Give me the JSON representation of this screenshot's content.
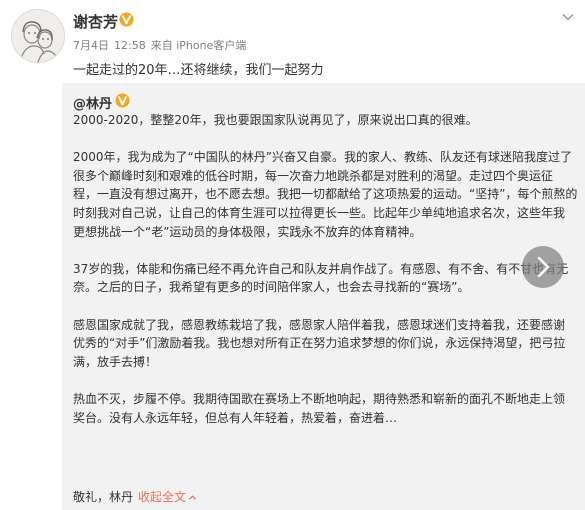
{
  "post": {
    "author_name": "谢杏芳",
    "date": "7月4日",
    "time": "12:58",
    "source": "来自 iPhone客户端",
    "text": "一起走过的20年…还将继续，我们一起努力"
  },
  "repost": {
    "author": "@林丹",
    "paragraphs": [
      "2000-2020，整整20年，我也要跟国家队说再见了，原来说出口真的很难。",
      "2000年，我为成为了“中国队的林丹”兴奋又自豪。我的家人、教练、队友还有球迷陪我度过了\n很多个巅峰时刻和艰难的低谷时期，每一次奋力地跳杀都是对胜利的渴望。走过四个奥运征\n程，一直没有想过离开，也不愿去想。我把一切都献给了这项热爱的运动。“坚持”，每个煎熬的\n时刻我对自己说，让自己的体育生涯可以拉得更长一些。比起年少单纯地追求名次，这些年我\n更想挑战一个“老”运动员的身体极限，实践永不放弃的体育精神。",
      "37岁的我，体能和伤痛已经不再允许自己和队友并肩作战了。有感恩、有不舍、有不甘也有无\n奈。之后的日子，我希望有更多的时间陪伴家人，也会去寻找新的“赛场”。",
      "感恩国家成就了我，感恩教练栽培了我，感恩家人陪伴着我，感恩球迷们支持着我，还要感谢\n优秀的“对手”们激励着我。我也想对所有正在努力追求梦想的你们说，永远保持渴望，把弓拉\n满，放手去搏！",
      "热血不灭，步履不停。我期待国歌在赛场上不断地响起，期待熟悉和崭新的面孔不断地走上领\n奖台。没有人永远年轻，但总有人年轻着，热爱着，奋进着…"
    ],
    "signoff": "敬礼，林丹",
    "collapse_label": "收起全文"
  },
  "colors": {
    "vip_badge": "#f5a623",
    "link": "#eb7350",
    "repost_bg": "#f2f2f2",
    "meta_text": "#808080"
  },
  "icons": {
    "vip_badge": "verified-v-icon",
    "menu": "chevron-down-icon",
    "next": "chevron-right-icon",
    "collapse": "chevron-up-icon"
  }
}
